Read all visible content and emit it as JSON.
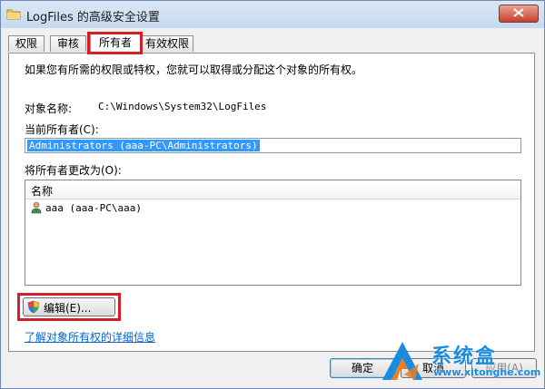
{
  "window": {
    "title": "LogFiles 的高级安全设置",
    "close_icon": "close-icon"
  },
  "tabs": [
    {
      "label": "权限"
    },
    {
      "label": "审核"
    },
    {
      "label": "所有者",
      "active": true
    },
    {
      "label": "有效权限"
    }
  ],
  "owner_page": {
    "info_text": "如果您有所需的权限或特权，您就可以取得或分配这个对象的所有权。",
    "object_name_label": "对象名称:",
    "object_name_value": "C:\\Windows\\System32\\LogFiles",
    "current_owner_label": "当前所有者(C):",
    "current_owner_value": "Administrators (aaa-PC\\Administrators)",
    "change_owner_label": "将所有者更改为(O):",
    "list": {
      "column_header": "名称",
      "rows": [
        {
          "name": "aaa (aaa-PC\\aaa)",
          "icon": "user-icon"
        }
      ]
    },
    "edit_button": "编辑(E)...",
    "learn_more_link": "了解对象所有权的详细信息"
  },
  "buttons": {
    "ok": "确定",
    "cancel": "取消",
    "apply": "应用(A)"
  },
  "watermark": {
    "title": "系统盒",
    "url": "www.xitonghe.com"
  },
  "colors": {
    "highlight_red": "#d21f2a",
    "selection_blue": "#3399ff",
    "link_blue": "#0066cc",
    "watermark_blue": "#1a8ce0"
  }
}
